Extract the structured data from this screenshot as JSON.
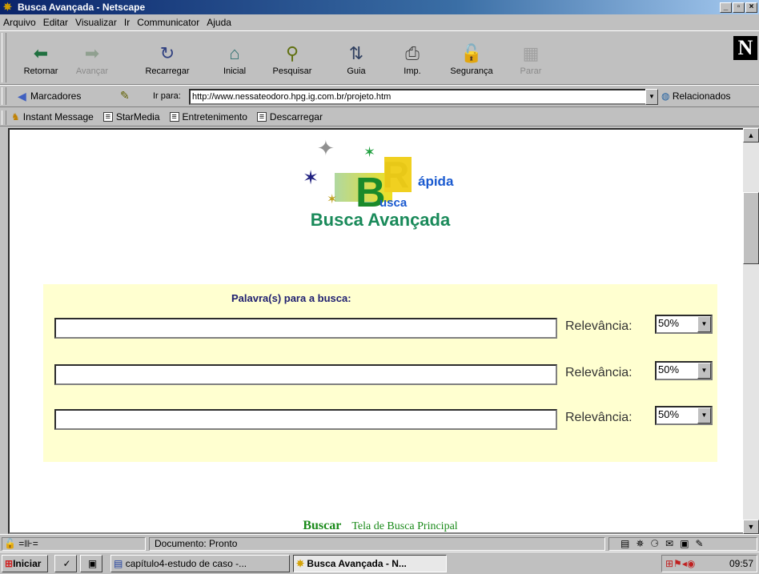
{
  "window": {
    "title": "Busca Avançada - Netscape"
  },
  "menu": [
    "Arquivo",
    "Editar",
    "Visualizar",
    "Ir",
    "Communicator",
    "Ajuda"
  ],
  "toolbar": {
    "buttons": [
      {
        "label": "Retornar",
        "icon": "back-arrow-icon",
        "enabled": true
      },
      {
        "label": "Avançar",
        "icon": "forward-arrow-icon",
        "enabled": false
      },
      {
        "label": "Recarregar",
        "icon": "reload-icon",
        "enabled": true
      },
      {
        "label": "Inicial",
        "icon": "home-icon",
        "enabled": true
      },
      {
        "label": "Pesquisar",
        "icon": "search-icon",
        "enabled": true
      },
      {
        "label": "Guia",
        "icon": "guide-icon",
        "enabled": true
      },
      {
        "label": "Imp.",
        "icon": "printer-icon",
        "enabled": true
      },
      {
        "label": "Segurança",
        "icon": "lock-icon",
        "enabled": true
      },
      {
        "label": "Parar",
        "icon": "stop-icon",
        "enabled": false
      }
    ]
  },
  "location": {
    "bookmarks_label": "Marcadores",
    "go_label": "Ir para:",
    "url": "http://www.nessateodoro.hpg.ig.com.br/projeto.htm",
    "related_label": "Relacionados"
  },
  "personal_toolbar": [
    "Instant Message",
    "StarMedia",
    "Entretenimento",
    "Descarregar"
  ],
  "page": {
    "logo": {
      "letter_b": "B",
      "letter_r": "R",
      "text_r": "ápida",
      "text_b": "usca"
    },
    "title": "Busca Avançada",
    "search_label": "Palavra(s) para a busca:",
    "rows": [
      {
        "value": "",
        "relevance_label": "Relevância:",
        "relevance": "50%"
      },
      {
        "value": "",
        "relevance_label": "Relevância:",
        "relevance": "50%"
      },
      {
        "value": "",
        "relevance_label": "Relevância:",
        "relevance": "50%"
      }
    ],
    "search_link": "Buscar",
    "main_link": "Tela de Busca Principal"
  },
  "status": {
    "text": "Documento: Pronto"
  },
  "taskbar": {
    "start": "Iniciar",
    "tasks": [
      {
        "label": "capítulo4-estudo de caso -...",
        "active": false
      },
      {
        "label": "Busca Avançada - N...",
        "active": true
      }
    ],
    "clock": "09:57"
  },
  "colors": {
    "title_green": "#1a8a5a",
    "panel_bg": "#ffffd0",
    "label_navy": "#202070"
  }
}
